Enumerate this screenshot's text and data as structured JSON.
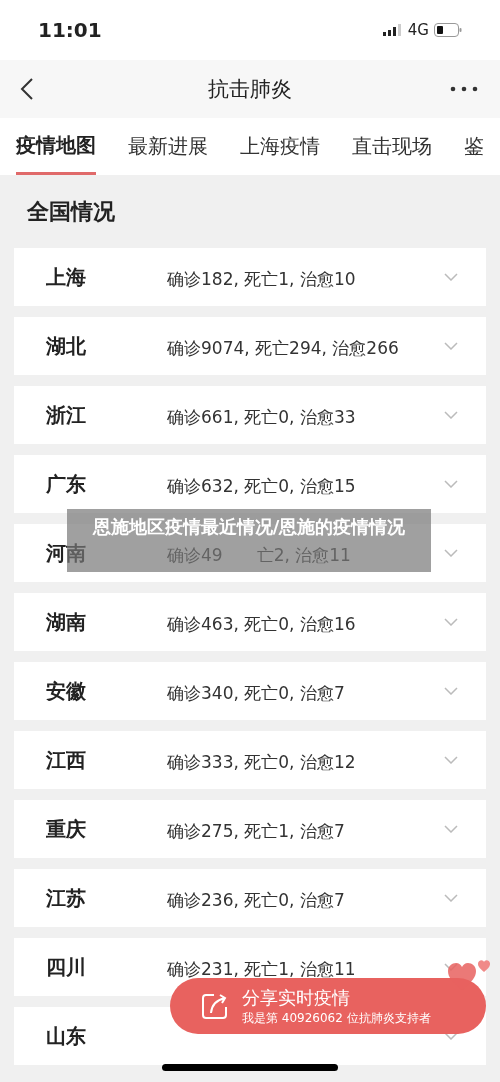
{
  "status_bar": {
    "time": "11:01",
    "network": "4G"
  },
  "nav": {
    "title": "抗击肺炎"
  },
  "tabs": [
    {
      "label": "疫情地图",
      "selected": true
    },
    {
      "label": "最新进展",
      "selected": false
    },
    {
      "label": "上海疫情",
      "selected": false
    },
    {
      "label": "直击现场",
      "selected": false
    },
    {
      "label": "鉴",
      "selected": false
    }
  ],
  "section_title": "全国情况",
  "regions": [
    {
      "name": "上海",
      "stats": "确诊182, 死亡1, 治愈10"
    },
    {
      "name": "湖北",
      "stats": "确诊9074, 死亡294, 治愈266"
    },
    {
      "name": "浙江",
      "stats": "确诊661, 死亡0, 治愈33"
    },
    {
      "name": "广东",
      "stats": "确诊632, 死亡0, 治愈15"
    },
    {
      "name": "河南",
      "stats": "确诊49",
      "stats_after": "亡2, 治愈11"
    },
    {
      "name": "湖南",
      "stats": "确诊463, 死亡0, 治愈16"
    },
    {
      "name": "安徽",
      "stats": "确诊340, 死亡0, 治愈7"
    },
    {
      "name": "江西",
      "stats": "确诊333, 死亡0, 治愈12"
    },
    {
      "name": "重庆",
      "stats": "确诊275, 死亡1, 治愈7"
    },
    {
      "name": "江苏",
      "stats": "确诊236, 死亡0, 治愈7"
    },
    {
      "name": "四川",
      "stats": "确诊231, 死亡1, 治愈11"
    },
    {
      "name": "山东"
    }
  ],
  "overlay_caption": "恩施地区疫情最近情况/恩施的疫情情况",
  "share_button": {
    "title": "分享实时疫情",
    "subtitle": "我是第 40926062 位抗肺炎支持者"
  }
}
